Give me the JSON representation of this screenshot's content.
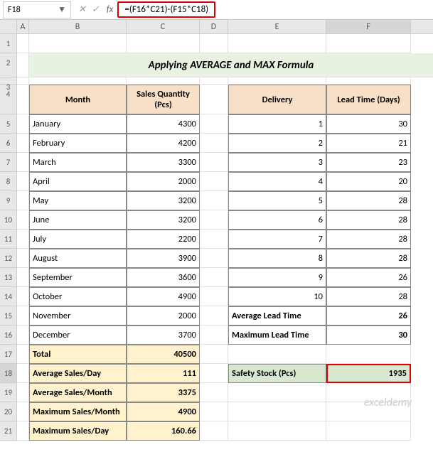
{
  "namebox": "F18",
  "formula": "=(F16*C21)-(F15*C18)",
  "cols": [
    "A",
    "B",
    "C",
    "D",
    "E",
    "F"
  ],
  "title": "Applying AVERAGE and MAX Formula",
  "hdr": {
    "month": "Month",
    "sq": "Sales Quantity (Pcs)",
    "del": "Delivery",
    "lt": "Lead Time (Days)"
  },
  "rows": [
    {
      "m": "January",
      "q": "4300",
      "d": "1",
      "l": "30"
    },
    {
      "m": "February",
      "q": "4200",
      "d": "2",
      "l": "21"
    },
    {
      "m": "March",
      "q": "3300",
      "d": "3",
      "l": "23"
    },
    {
      "m": "April",
      "q": "2000",
      "d": "4",
      "l": "20"
    },
    {
      "m": "May",
      "q": "3200",
      "d": "5",
      "l": "28"
    },
    {
      "m": "June",
      "q": "3200",
      "d": "6",
      "l": "28"
    },
    {
      "m": "July",
      "q": "2200",
      "d": "7",
      "l": "28"
    },
    {
      "m": "August",
      "q": "3900",
      "d": "8",
      "l": "28"
    },
    {
      "m": "September",
      "q": "3600",
      "d": "9",
      "l": "26"
    },
    {
      "m": "October",
      "q": "4900",
      "d": "10",
      "l": "28"
    }
  ],
  "r15": {
    "m": "November",
    "q": "2000",
    "el": "Average Lead Time",
    "ev": "26"
  },
  "r16": {
    "m": "December",
    "q": "3700",
    "el": "Maximum Lead Time",
    "ev": "30"
  },
  "r17": {
    "b": "Total",
    "c": "40500"
  },
  "r18": {
    "b": "Average Sales/Day",
    "c": "111",
    "e": "Safety Stock (Pcs)",
    "f": "1935"
  },
  "r19": {
    "b": "Average Sales/Month",
    "c": "3375"
  },
  "r20": {
    "b": "Maximum Sales/Month",
    "c": "4900"
  },
  "r21": {
    "b": "Maximum Sales/Day",
    "c": "160.66"
  },
  "wm": "exceldemy"
}
